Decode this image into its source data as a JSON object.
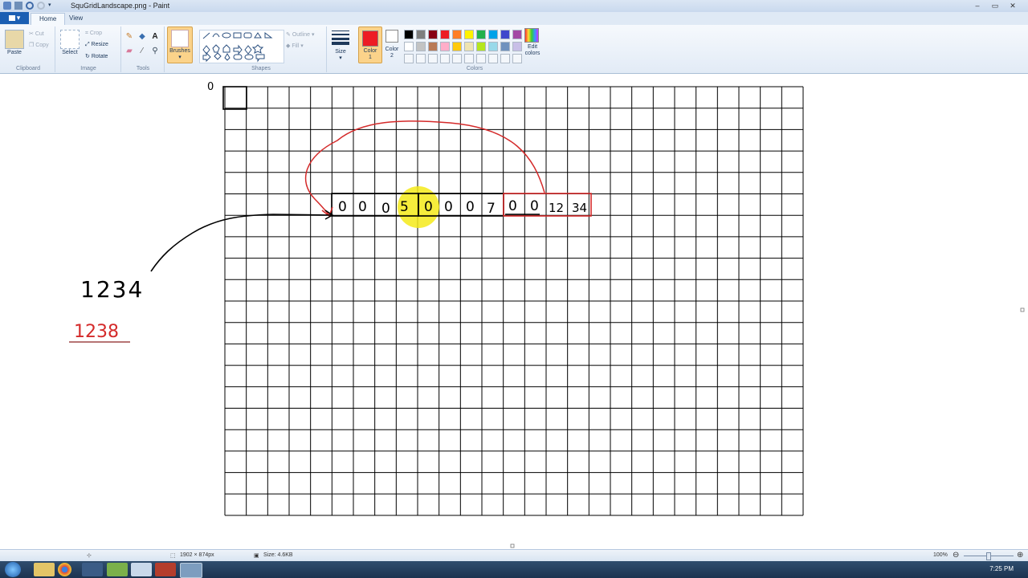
{
  "window": {
    "title": "SquGridLandscape.png - Paint"
  },
  "tabs": {
    "app_menu": "▾",
    "home": "Home",
    "view": "View"
  },
  "ribbon": {
    "clipboard": {
      "paste": "Paste",
      "cut": "Cut",
      "copy": "Copy",
      "label": "Clipboard"
    },
    "image": {
      "select": "Select",
      "crop": "Crop",
      "resize": "Resize",
      "rotate": "Rotate",
      "label": "Image"
    },
    "tools": {
      "label": "Tools"
    },
    "brushes": {
      "label": "Brushes"
    },
    "shapes": {
      "outline": "Outline",
      "fill": "Fill",
      "label": "Shapes"
    },
    "size": {
      "label": "Size"
    },
    "color1": {
      "label": "Color 1"
    },
    "color2": {
      "label": "Color 2"
    },
    "colors": {
      "label": "Colors",
      "edit": "Edit colors",
      "palette_row1": [
        "#000000",
        "#7f7f7f",
        "#880015",
        "#ed1c24",
        "#ff7f27",
        "#fff200",
        "#22b14c",
        "#00a2e8",
        "#3f48cc",
        "#a349a4"
      ],
      "palette_row2": [
        "#ffffff",
        "#c3c3c3",
        "#b97a57",
        "#ffaec9",
        "#ffc90e",
        "#efe4b0",
        "#b5e61d",
        "#99d9ea",
        "#7092be",
        "#c8bfe7"
      ]
    },
    "active_color1": "#ed1c24",
    "active_color2": "#ffffff"
  },
  "canvas": {
    "top_zero": "0",
    "left_number": "1234",
    "left_red_number": "1238",
    "cells_block1": [
      "0",
      "0",
      "0",
      "5"
    ],
    "cells_block2": [
      "0",
      "0",
      "0",
      "7"
    ],
    "cells_block3": [
      "0",
      "0",
      "12",
      "34"
    ],
    "ink_black": "#000000",
    "ink_red": "#d42a2a",
    "highlight": "#f5ea1a"
  },
  "status": {
    "dimensions": "1902 × 874px",
    "size": "Size: 4.6KB",
    "zoom": "100%"
  },
  "taskbar": {
    "clock": "7:25 PM"
  }
}
